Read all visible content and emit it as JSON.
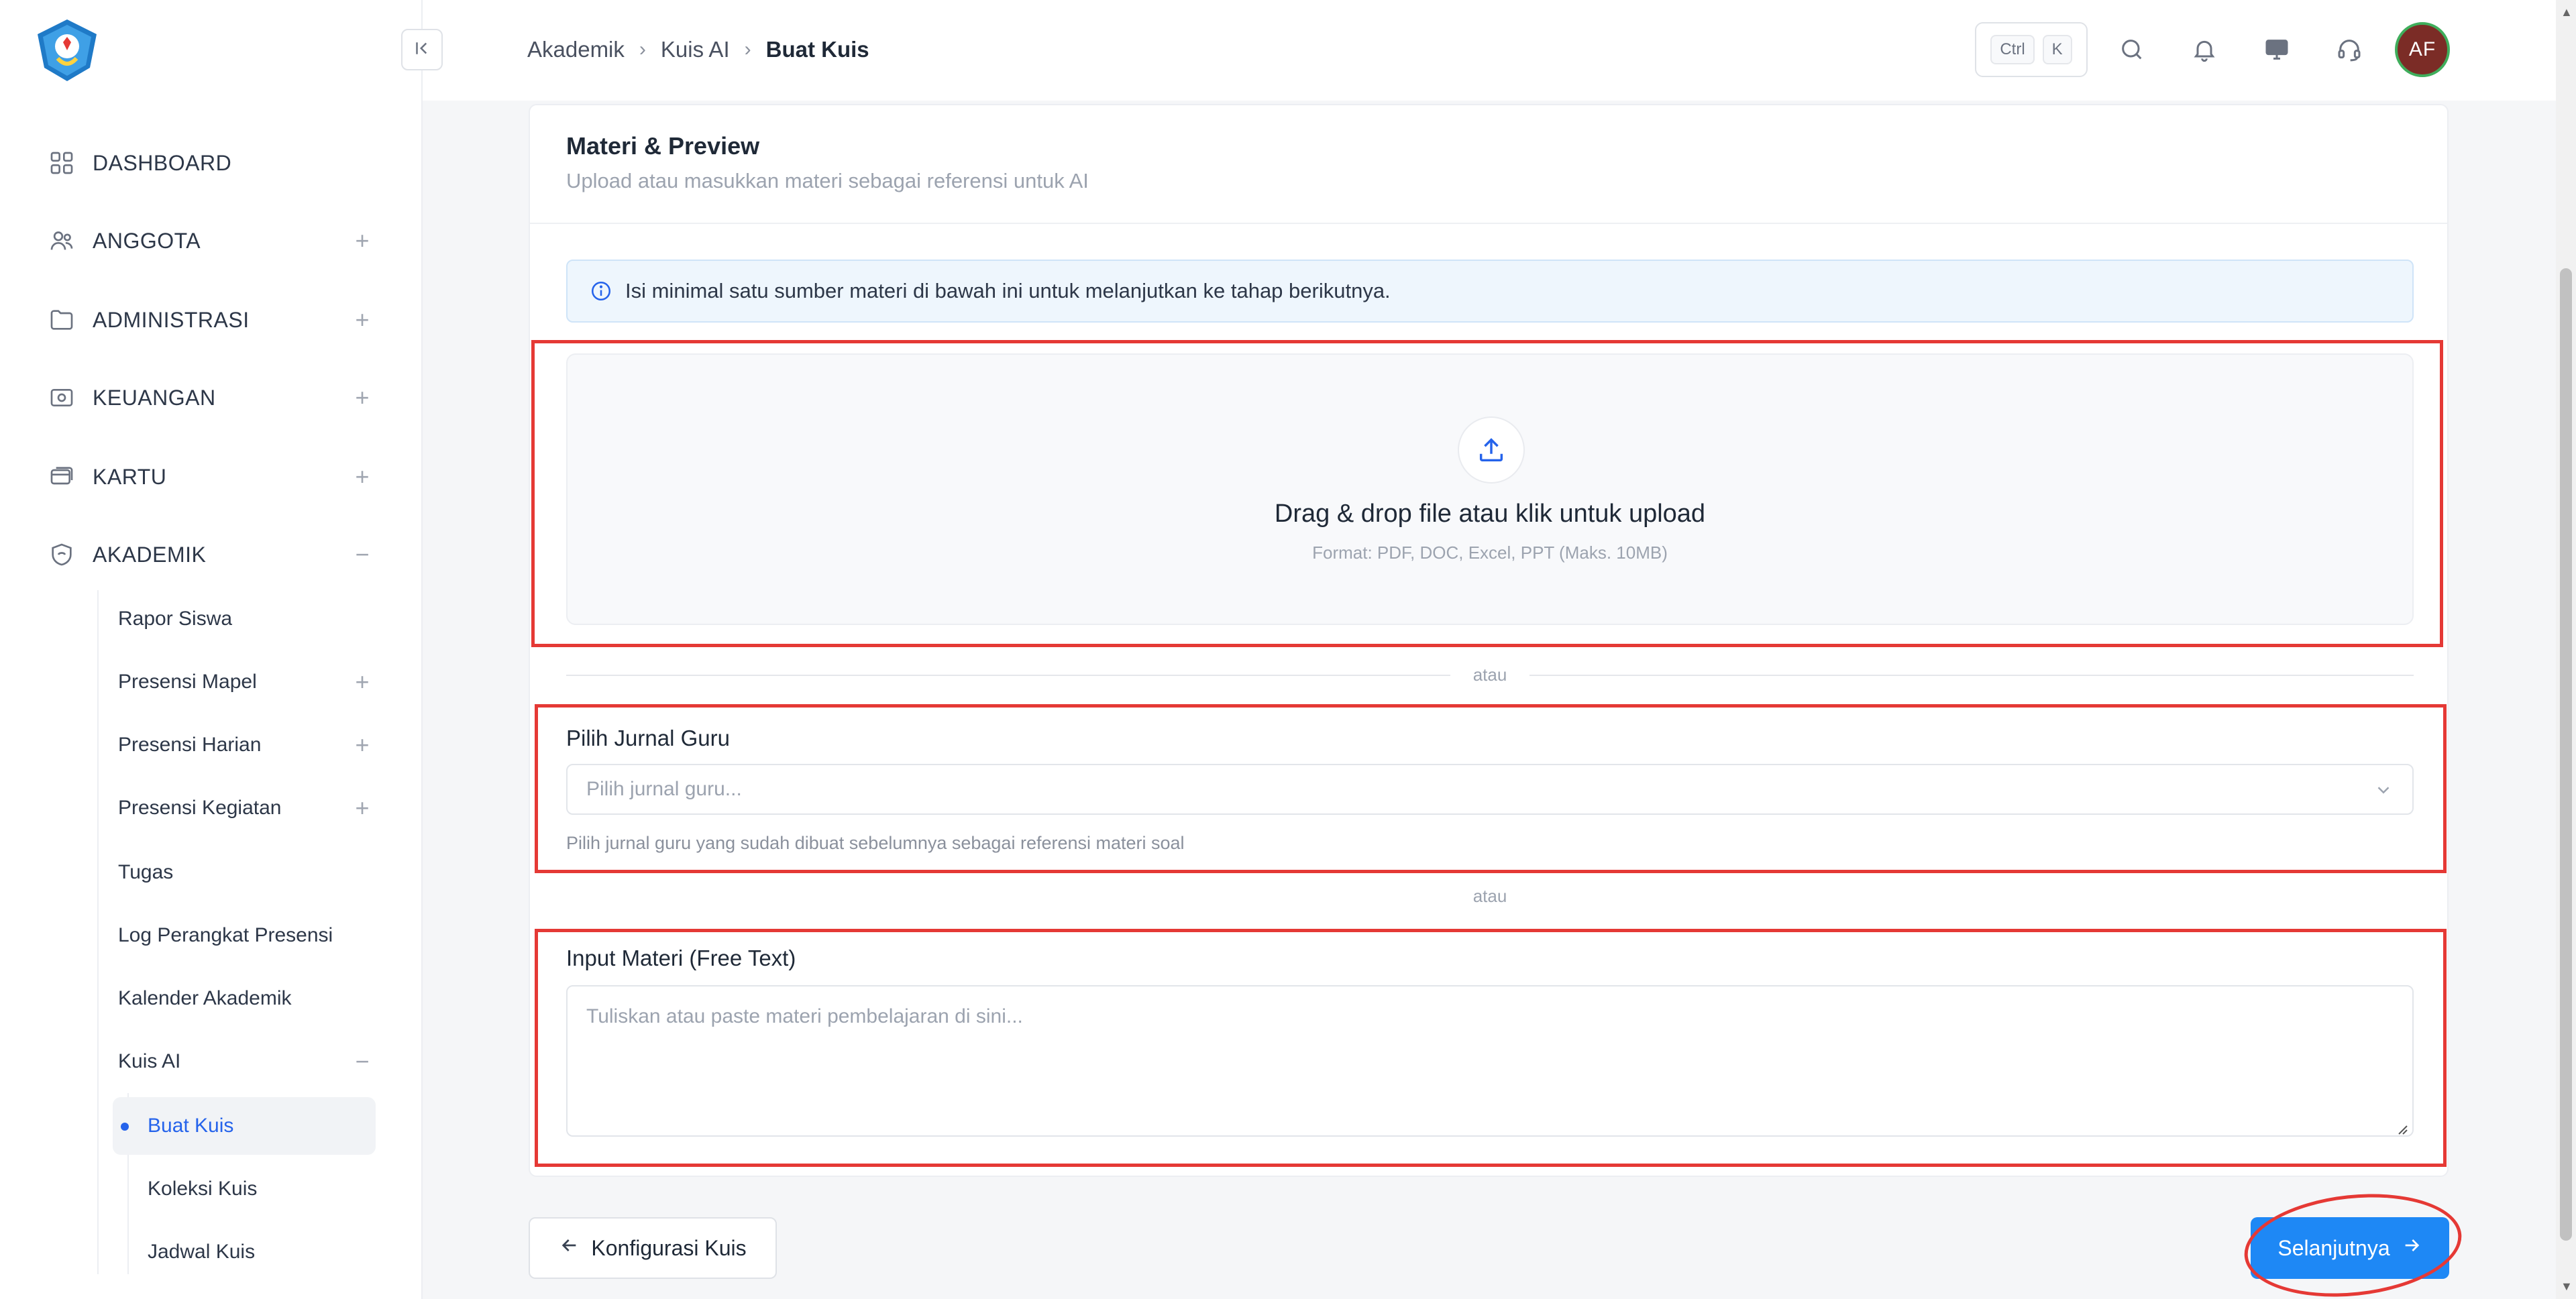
{
  "sidebar": {
    "menu": [
      {
        "label": "DASHBOARD",
        "icon": "grid-icon",
        "expander": ""
      },
      {
        "label": "ANGGOTA",
        "icon": "users-icon",
        "expander": "+"
      },
      {
        "label": "ADMINISTRASI",
        "icon": "folder-icon",
        "expander": "+"
      },
      {
        "label": "KEUANGAN",
        "icon": "money-icon",
        "expander": "+"
      },
      {
        "label": "KARTU",
        "icon": "card-icon",
        "expander": "+"
      },
      {
        "label": "AKADEMIK",
        "icon": "academic-icon",
        "expander": "−"
      }
    ],
    "akademik_items": [
      {
        "label": "Rapor Siswa",
        "expander": ""
      },
      {
        "label": "Presensi Mapel",
        "expander": "+"
      },
      {
        "label": "Presensi Harian",
        "expander": "+"
      },
      {
        "label": "Presensi Kegiatan",
        "expander": "+"
      },
      {
        "label": "Tugas",
        "expander": ""
      },
      {
        "label": "Log Perangkat Presensi",
        "expander": ""
      },
      {
        "label": "Kalender Akademik",
        "expander": ""
      },
      {
        "label": "Kuis AI",
        "expander": "−"
      }
    ],
    "kuis_items": [
      {
        "label": "Buat Kuis",
        "active": true
      },
      {
        "label": "Koleksi Kuis",
        "active": false
      },
      {
        "label": "Jadwal Kuis",
        "active": false
      }
    ]
  },
  "header": {
    "breadcrumb": [
      "Akademik",
      "Kuis AI",
      "Buat Kuis"
    ],
    "shortcut": {
      "key1": "Ctrl",
      "key2": "K"
    },
    "avatar_initials": "AF"
  },
  "card": {
    "title": "Materi & Preview",
    "subtitle": "Upload atau masukkan materi sebagai referensi untuk AI",
    "info": "Isi minimal satu sumber materi di bawah ini untuk melanjutkan ke tahap berikutnya.",
    "upload": {
      "title": "Drag & drop file atau klik untuk upload",
      "formats": "Format: PDF, DOC, Excel, PPT (Maks. 10MB)"
    },
    "separator": "atau",
    "journal": {
      "label": "Pilih Jurnal Guru",
      "placeholder": "Pilih jurnal guru...",
      "hint": "Pilih jurnal guru yang sudah dibuat sebelumnya sebagai referensi materi soal"
    },
    "material": {
      "label": "Input Materi (Free Text)",
      "placeholder": "Tuliskan atau paste materi pembelajaran di sini..."
    }
  },
  "footer": {
    "back_label": "Konfigurasi Kuis",
    "next_label": "Selanjutnya"
  },
  "colors": {
    "primary": "#1e88f5",
    "annotation": "#e53935",
    "avatar_bg": "#7b2c26"
  }
}
